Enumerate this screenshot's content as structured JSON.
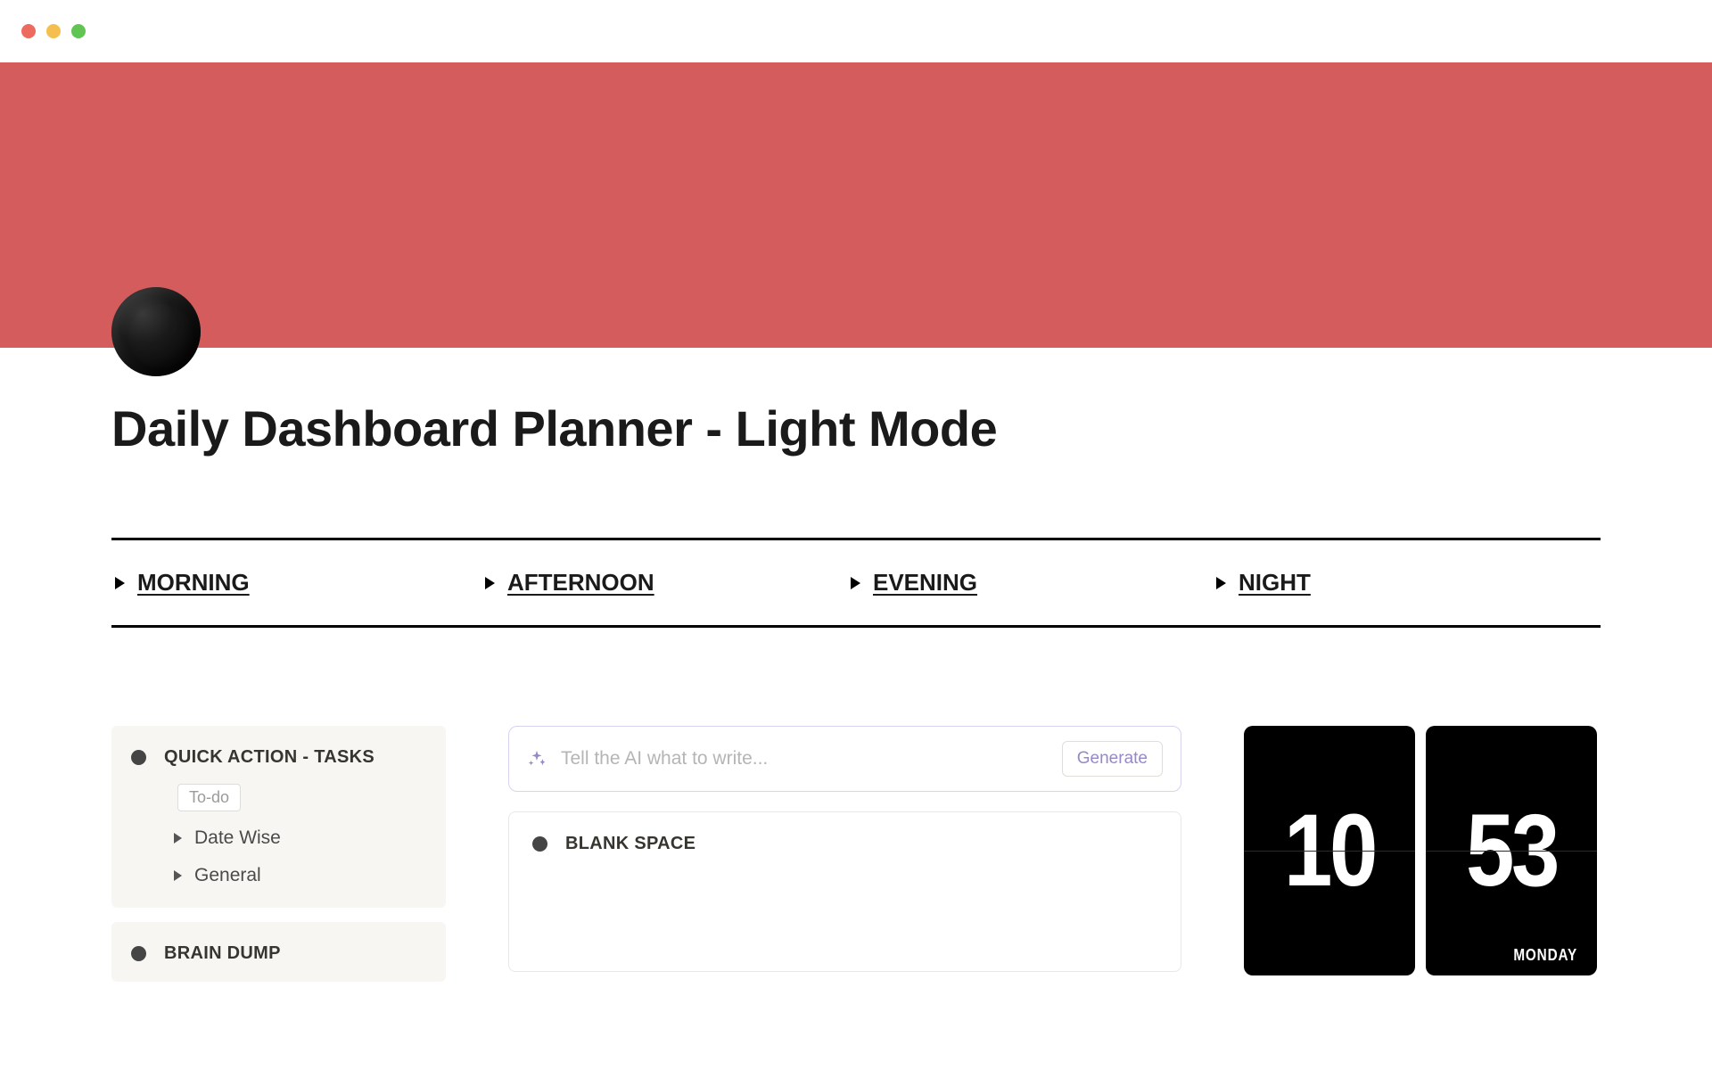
{
  "page": {
    "title": "Daily Dashboard Planner - Light Mode"
  },
  "toggles": [
    {
      "label": "MORNING"
    },
    {
      "label": "AFTERNOON"
    },
    {
      "label": "EVENING"
    },
    {
      "label": "NIGHT"
    }
  ],
  "sidebar": {
    "quick_action": {
      "title": "QUICK ACTION - TASKS",
      "todo_chip": "To-do",
      "items": [
        {
          "label": "Date Wise"
        },
        {
          "label": "General"
        }
      ]
    },
    "brain_dump": {
      "title": "BRAIN DUMP"
    }
  },
  "ai": {
    "placeholder": "Tell the AI what to write...",
    "generate_label": "Generate"
  },
  "blank_space": {
    "title": "BLANK SPACE"
  },
  "clock": {
    "hour": "10",
    "minute": "53",
    "day": "MONDAY"
  },
  "colors": {
    "banner": "#d45c5c"
  }
}
